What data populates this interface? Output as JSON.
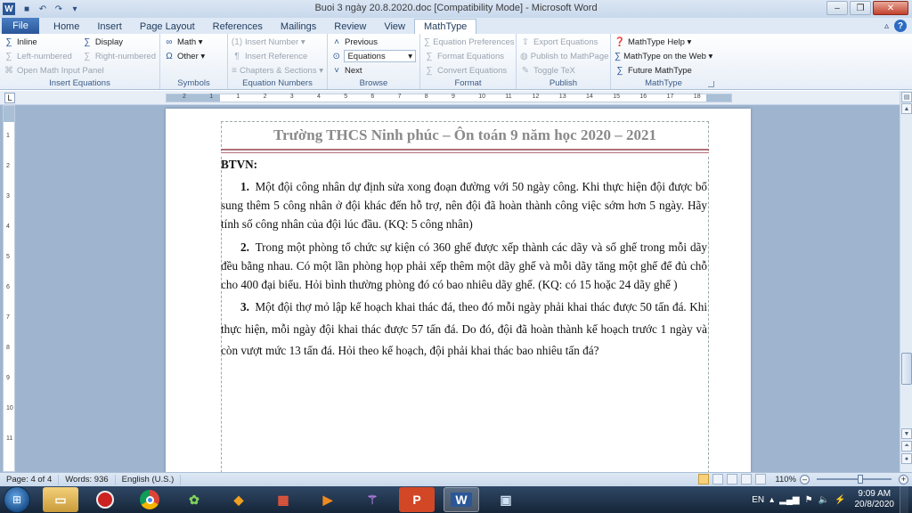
{
  "window": {
    "title": "Buoi 3 ngày 20.8.2020.doc [Compatibility Mode] - Microsoft Word",
    "app_logo": "W"
  },
  "tabs": {
    "file": "File",
    "items": [
      "Home",
      "Insert",
      "Page Layout",
      "References",
      "Mailings",
      "Review",
      "View",
      "MathType"
    ],
    "active": "MathType"
  },
  "ribbon": {
    "insert_equations": {
      "label": "Insert Equations",
      "inline": "Inline",
      "display": "Display",
      "left_numbered": "Left-numbered",
      "right_numbered": "Right-numbered",
      "open_math_input_panel": "Open Math Input Panel"
    },
    "symbols": {
      "label": "Symbols",
      "math": "Math",
      "other": "Other"
    },
    "equation_numbers": {
      "label": "Equation Numbers",
      "insert_number": "Insert Number",
      "insert_reference": "Insert Reference",
      "chapters_sections": "Chapters & Sections"
    },
    "browse": {
      "label": "Browse",
      "previous": "Previous",
      "equations_select": "Equations",
      "next": "Next"
    },
    "format": {
      "label": "Format",
      "equation_preferences": "Equation Preferences",
      "format_equations": "Format Equations",
      "convert_equations": "Convert Equations"
    },
    "publish": {
      "label": "Publish",
      "export_equations": "Export Equations",
      "publish_to_mathpage": "Publish to MathPage",
      "toggle_tex": "Toggle TeX"
    },
    "mathtype": {
      "label": "MathType",
      "help": "MathType Help",
      "on_the_web": "MathType on the Web",
      "future": "Future MathType"
    }
  },
  "ruler": {
    "numbers": [
      "2",
      "1",
      "1",
      "2",
      "3",
      "4",
      "5",
      "6",
      "7",
      "8",
      "9",
      "10",
      "11",
      "12",
      "13",
      "14",
      "15",
      "16",
      "17",
      "18"
    ],
    "vertical_numbers": [
      "1",
      "2",
      "3",
      "4",
      "5",
      "6",
      "7",
      "8",
      "9",
      "10",
      "11"
    ]
  },
  "document": {
    "header_title": "Trường THCS Ninh phúc – Ôn toán 9 năm học 2020 – 2021",
    "section_heading": "BTVN:",
    "problems": [
      {
        "number": "1.",
        "text": "Một đội công nhân dự định sửa xong đoạn đường với 50 ngày công. Khi thực hiện đội được bổ sung thêm 5 công nhân ở đội khác đến hỗ trợ, nên đội đã hoàn thành công việc sớm hơn 5 ngày. Hãy tính số công nhân của đội lúc đầu. (KQ: 5 công nhân)"
      },
      {
        "number": "2.",
        "text": "Trong một phòng tổ chức sự kiện có 360 ghế được xếp thành các dãy và số ghế trong mỗi dãy đều bằng nhau. Có một lần phòng họp phải xếp thêm một dãy ghế và mỗi dãy tăng một ghế để đủ chỗ cho 400 đại biểu. Hỏi bình thường phòng đó có bao nhiêu dãy ghế. (KQ: có 15 hoặc 24 dãy ghế )"
      },
      {
        "number": "3.",
        "text": "Một đội thợ mỏ lập kế hoạch khai thác đá, theo đó mỗi ngày phải khai thác được 50 tấn đá. Khi thực hiện, mỗi ngày đội khai thác được 57 tấn đá. Do đó, đội đã hoàn thành kế hoạch trước 1 ngày và còn vượt mức 13 tấn đá. Hỏi theo kế hoạch, đội phải khai thác bao nhiêu tấn đá?"
      }
    ]
  },
  "status": {
    "page": "Page: 4 of 4",
    "words": "Words: 936",
    "language": "English (U.S.)",
    "zoom": "110%"
  },
  "taskbar": {
    "language": "EN",
    "time": "9:09 AM",
    "date": "20/8/2020"
  }
}
